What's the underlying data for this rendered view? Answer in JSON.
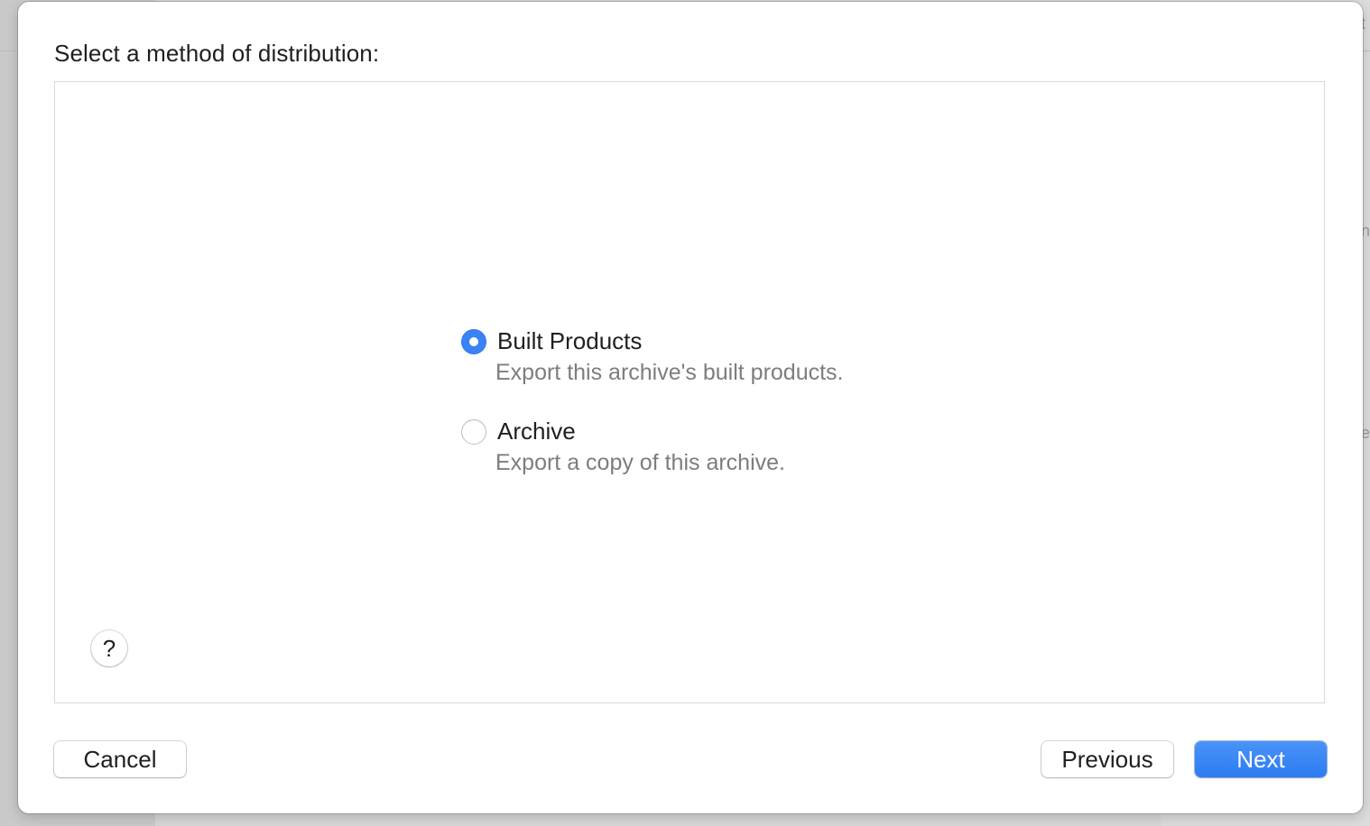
{
  "sheet": {
    "heading": "Select a method of distribution:"
  },
  "options": [
    {
      "title": "Built Products",
      "description": "Export this archive's built products.",
      "selected": true
    },
    {
      "title": "Archive",
      "description": "Export a copy of this archive.",
      "selected": false
    }
  ],
  "help": {
    "label": "?"
  },
  "buttons": {
    "cancel": "Cancel",
    "previous": "Previous",
    "next": "Next"
  },
  "background": {
    "fragment_1": "t",
    "fragment_2": "n",
    "fragment_3": "e"
  },
  "colors": {
    "accent": "#3b82f6",
    "description_text": "#7d7d7d"
  }
}
